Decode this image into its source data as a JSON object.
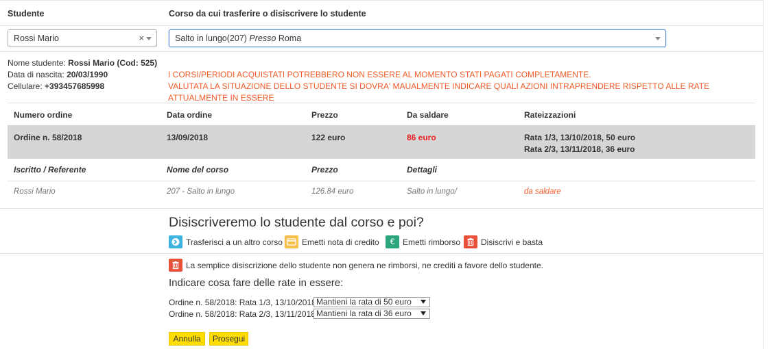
{
  "header": {
    "student_col": "Studente",
    "course_col": "Corso da cui trasferire o disiscrivere lo studente"
  },
  "selects": {
    "student_value": "Rossi Mario",
    "clear_glyph": "×",
    "course_value": "Salto in lungo(207)",
    "course_presso": "Presso",
    "course_city": "Roma"
  },
  "student_info": {
    "name_label": "Nome studente:",
    "name_value": "Rossi Mario (Cod: 525)",
    "birth_label": "Data di nascita:",
    "birth_value": "20/03/1990",
    "phone_label": "Cellulare:",
    "phone_value": "+393457685998"
  },
  "warning": {
    "line1": "I CORSI/PERIODI ACQUISTATI POTREBBERO NON ESSERE AL MOMENTO STATI PAGATI COMPLETAMENTE.",
    "line2": "VALUTATA LA SITUAZIONE DELLO STUDENTE SI DOVRA' MAUALMENTE INDICARE QUALI AZIONI INTRAPRENDERE RISPETTO ALLE RATE ATTUALMENTE IN ESSERE"
  },
  "orders_table": {
    "columns": [
      "Numero ordine",
      "Data ordine",
      "Prezzo",
      "Da saldare",
      "Rateizzazioni"
    ],
    "row": {
      "order": "Ordine n. 58/2018",
      "date": "13/09/2018",
      "price": "122 euro",
      "due": "86 euro",
      "rate1": "Rata 1/3, 13/10/2018, 50 euro",
      "rate2": "Rata 2/3, 13/11/2018, 36 euro"
    },
    "sub_columns": [
      "Iscritto / Referente",
      "Nome del corso",
      "Prezzo",
      "Dettagli"
    ],
    "sub_row": {
      "enrolled": "Rossi Mario",
      "course": "207 - Salto in lungo",
      "price": "126.84 euro",
      "details": "Salto in lungo/",
      "status": "da saldare"
    }
  },
  "question": "Disiscriveremo lo studente dal corso e poi?",
  "actions": {
    "transfer": "Trasferisci a un altro corso",
    "credit": "Emetti nota di credito",
    "refund": "Emetti rimborso",
    "unsubscribe": "Disiscrivi e basta",
    "refund_glyph": "€"
  },
  "notice": "La semplice disiscrizione dello studente non genera ne rimborsi, ne crediti a favore dello studente.",
  "rates_question": "Indicare cosa fare delle rate in essere:",
  "rates": [
    {
      "label": "Ordine n. 58/2018: Rata 1/3, 13/10/2018,",
      "option": "Mantieni la rata di 50 euro"
    },
    {
      "label": "Ordine n. 58/2018: Rata 2/3, 13/11/2018,",
      "option": "Mantieni la rata di 36 euro"
    }
  ],
  "buttons": {
    "cancel": "Annulla",
    "proceed": "Prosegui"
  },
  "colors": {
    "warning": "#f05a28",
    "due": "#e82020",
    "button": "#ffdd00"
  }
}
